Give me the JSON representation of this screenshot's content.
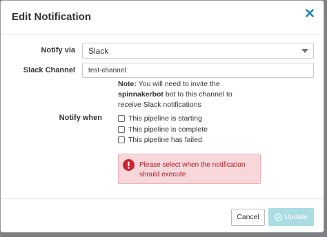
{
  "modal": {
    "title": "Edit Notification",
    "close_icon": "close-icon"
  },
  "form": {
    "notify_via": {
      "label": "Notify via",
      "selected": "Slack"
    },
    "slack_channel": {
      "label": "Slack Channel",
      "value": "test-channel"
    },
    "note": {
      "prefix": "Note:",
      "text_before": " You will need to invite the",
      "bot_name": "spinnakerbot",
      "text_after": " bot to this channel to receive Slack notifications"
    },
    "notify_when": {
      "label": "Notify when",
      "options": [
        {
          "label": "This pipeline is starting",
          "checked": false
        },
        {
          "label": "This pipeline is complete",
          "checked": false
        },
        {
          "label": "This pipeline has failed",
          "checked": false
        }
      ]
    },
    "error": {
      "icon": "exclamation-circle-icon",
      "message": "Please select when the notification should execute",
      "color": "#a11d24",
      "background": "#f8d7da"
    }
  },
  "footer": {
    "cancel_label": "Cancel",
    "update_label": "Update",
    "update_icon": "check-circle-icon",
    "update_color": "#a9dde3"
  }
}
